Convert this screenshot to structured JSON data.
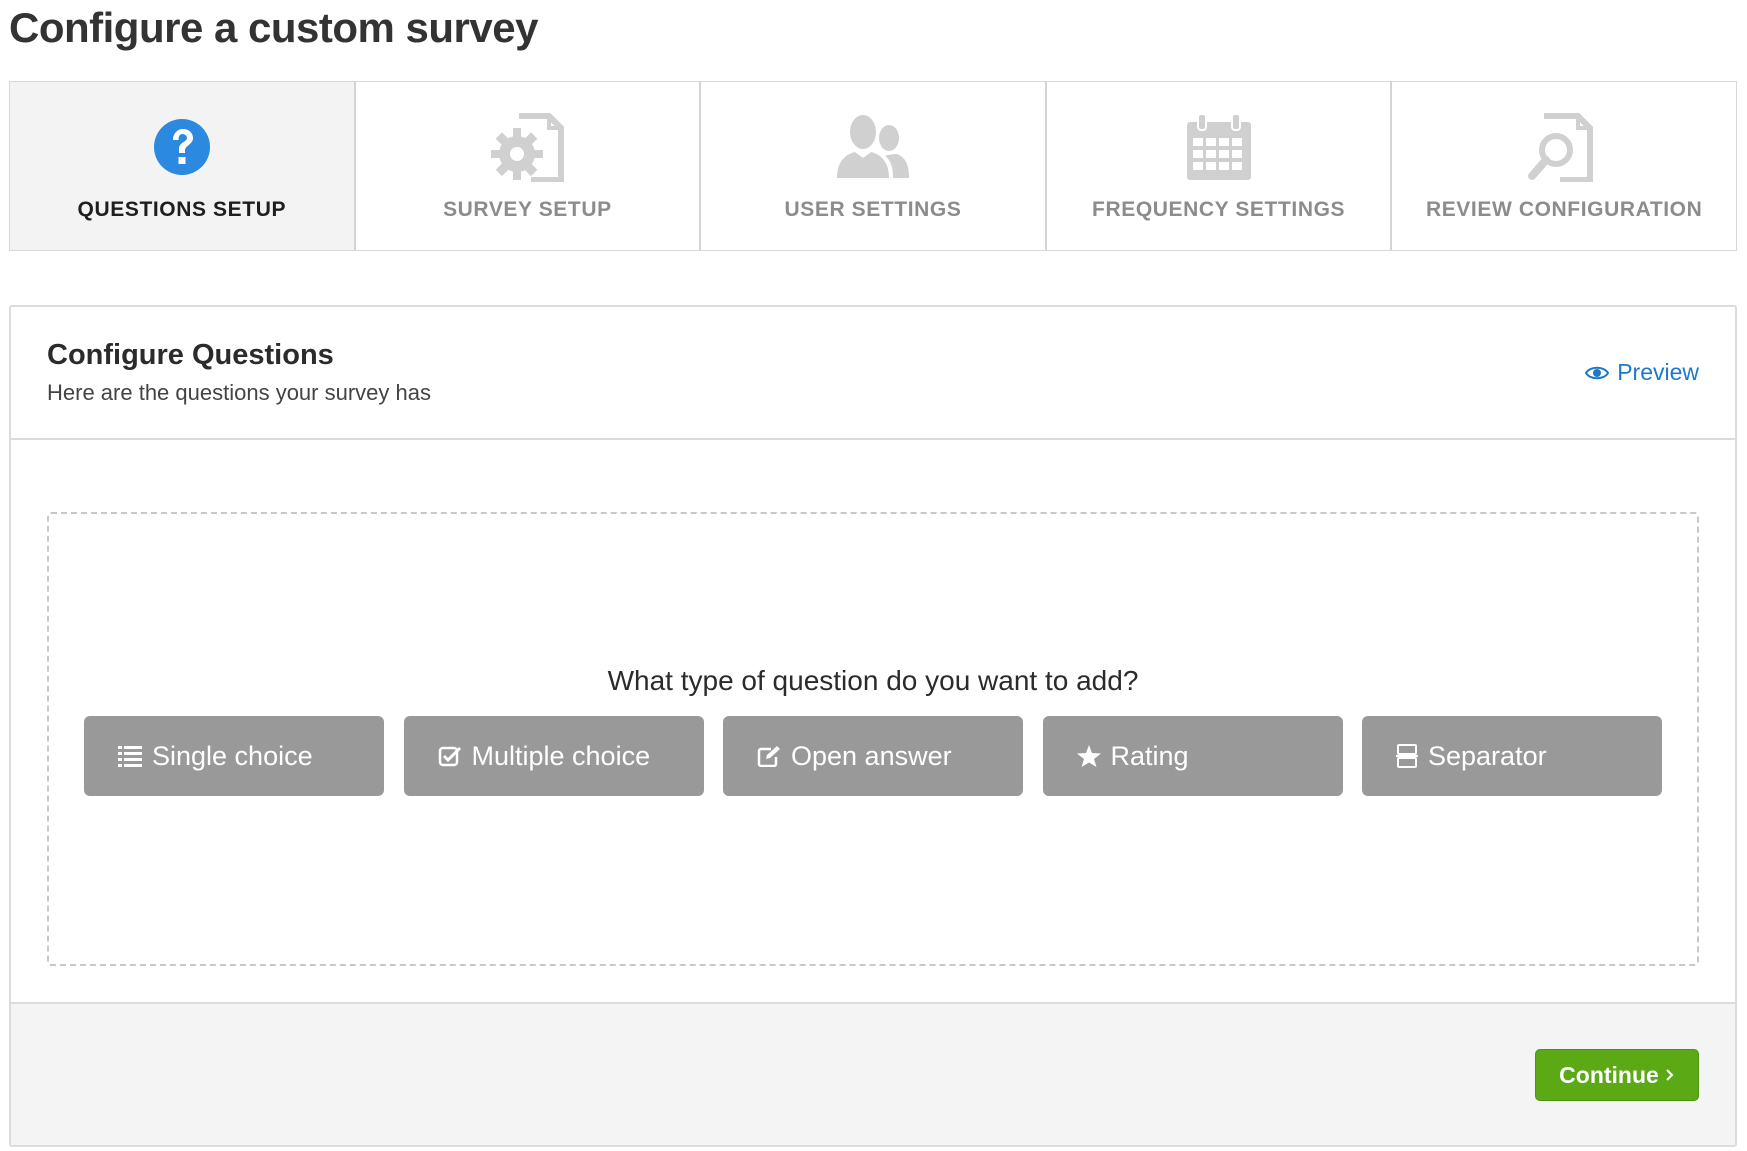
{
  "page": {
    "title": "Configure a custom survey"
  },
  "steps": [
    {
      "label": "QUESTIONS SETUP",
      "icon": "question-circle-icon",
      "active": true
    },
    {
      "label": "SURVEY SETUP",
      "icon": "gear-document-icon",
      "active": false
    },
    {
      "label": "USER SETTINGS",
      "icon": "users-icon",
      "active": false
    },
    {
      "label": "FREQUENCY SETTINGS",
      "icon": "calendar-icon",
      "active": false
    },
    {
      "label": "REVIEW CONFIGURATION",
      "icon": "search-document-icon",
      "active": false
    }
  ],
  "panel": {
    "title": "Configure Questions",
    "subtitle": "Here are the questions your survey has",
    "preview_label": "Preview",
    "prompt": "What type of question do you want to add?",
    "question_types": [
      {
        "label": "Single choice",
        "icon": "list-icon"
      },
      {
        "label": "Multiple choice",
        "icon": "checkbox-icon"
      },
      {
        "label": "Open answer",
        "icon": "edit-icon"
      },
      {
        "label": "Rating",
        "icon": "star-icon"
      },
      {
        "label": "Separator",
        "icon": "separator-icon"
      }
    ],
    "continue_label": "Continue"
  },
  "colors": {
    "accent_blue": "#1f78c8",
    "active_icon": "#2b8ae0",
    "inactive_icon": "#d0d0d0",
    "button_gray": "#999999",
    "continue_green": "#5aa915"
  }
}
